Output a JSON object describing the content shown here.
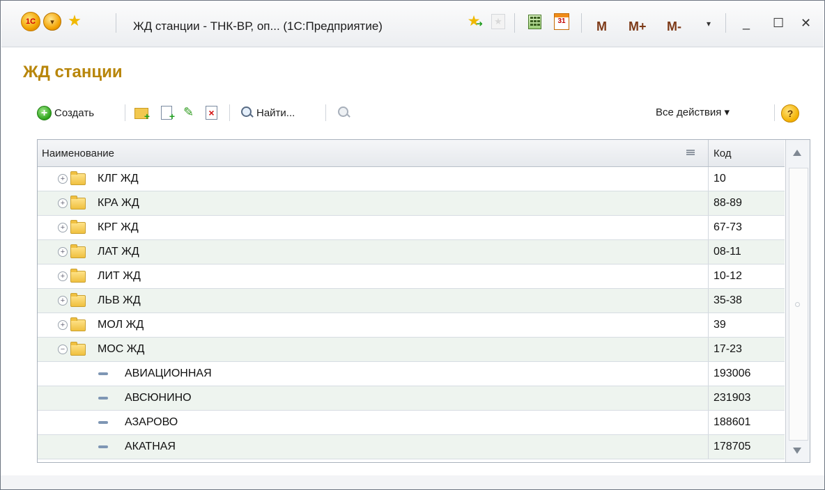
{
  "window": {
    "title": "ЖД станции - ТНК-ВР, оп... (1С:Предприятие)",
    "logo_text": "1С",
    "memory_buttons": [
      "M",
      "M+",
      "M-"
    ],
    "calendar_day": "31"
  },
  "page": {
    "title": "ЖД станции"
  },
  "toolbar": {
    "create_label": "Создать",
    "find_label": "Найти...",
    "all_actions_label": "Все действия ▾",
    "help_label": "?"
  },
  "table": {
    "columns": {
      "name": "Наименование",
      "code": "Код"
    },
    "rows": [
      {
        "name": "КЛГ ЖД",
        "code": "10",
        "type": "group",
        "expander": "+"
      },
      {
        "name": "КРА ЖД",
        "code": "88-89",
        "type": "group",
        "expander": "+"
      },
      {
        "name": "КРГ ЖД",
        "code": "67-73",
        "type": "group",
        "expander": "+"
      },
      {
        "name": "ЛАТ ЖД",
        "code": "08-11",
        "type": "group",
        "expander": "+"
      },
      {
        "name": "ЛИТ ЖД",
        "code": "10-12",
        "type": "group",
        "expander": "+"
      },
      {
        "name": "ЛЬВ ЖД",
        "code": "35-38",
        "type": "group",
        "expander": "+"
      },
      {
        "name": "МОЛ ЖД",
        "code": "39",
        "type": "group",
        "expander": "+"
      },
      {
        "name": "МОС ЖД",
        "code": "17-23",
        "type": "group",
        "expander": "−"
      },
      {
        "name": "АВИАЦИОННАЯ",
        "code": "193006",
        "type": "item"
      },
      {
        "name": "АВСЮНИНО",
        "code": "231903",
        "type": "item"
      },
      {
        "name": "АЗАРОВО",
        "code": "188601",
        "type": "item"
      },
      {
        "name": "АКАТНАЯ",
        "code": "178705",
        "type": "item"
      }
    ]
  },
  "colors": {
    "title_gold": "#b8860b",
    "row_alt": "#eef4ef",
    "border": "#aab2bd"
  }
}
